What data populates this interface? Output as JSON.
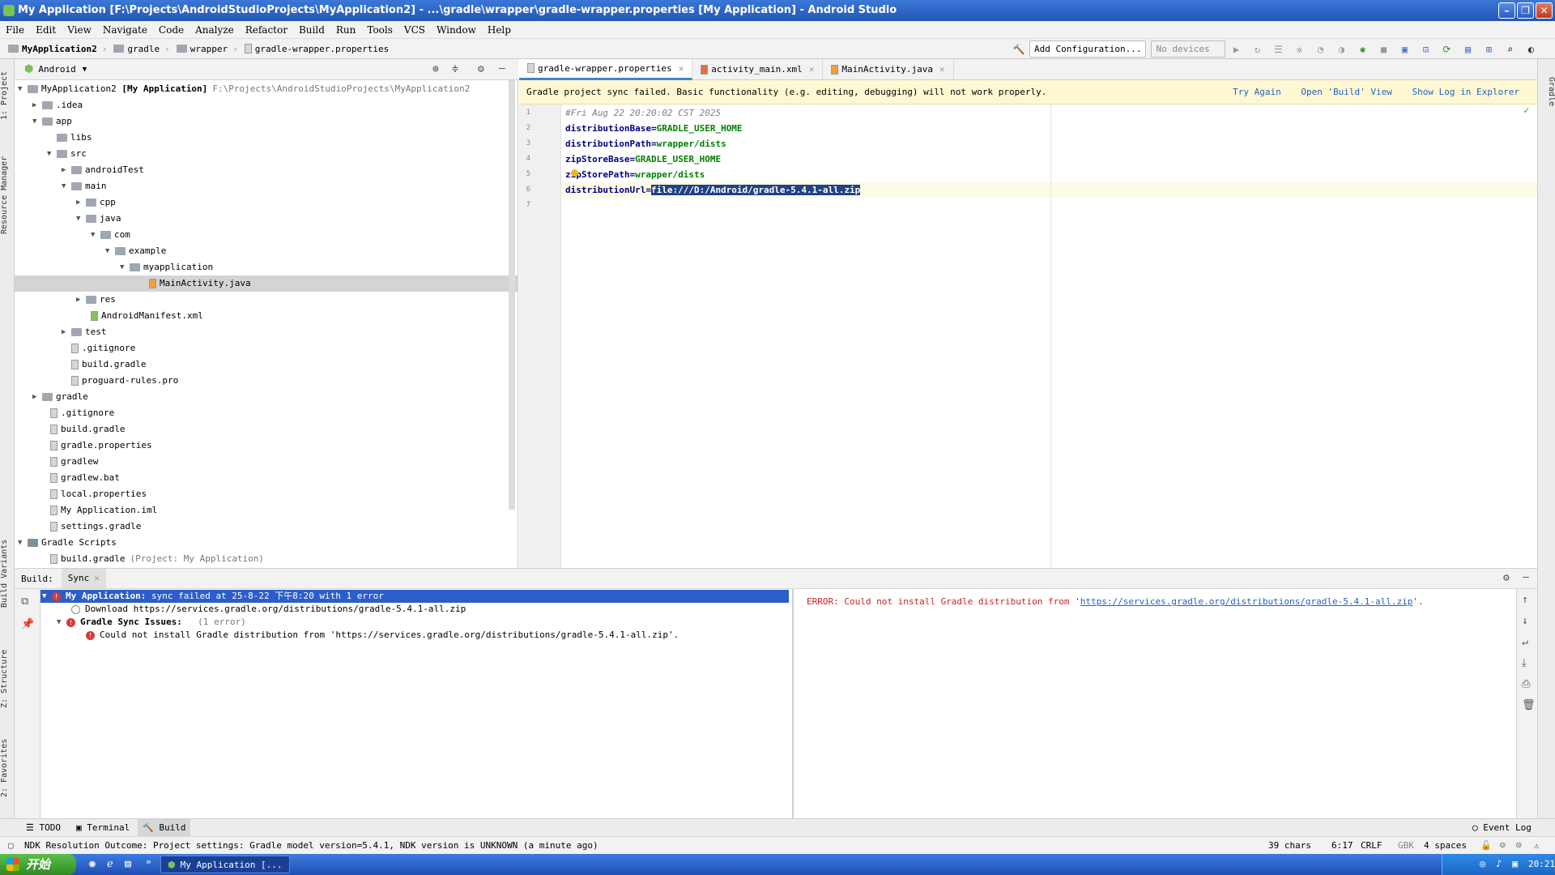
{
  "window": {
    "title": "My Application [F:\\Projects\\AndroidStudioProjects\\MyApplication2] - ...\\gradle\\wrapper\\gradle-wrapper.properties [My Application] - Android Studio"
  },
  "menu": [
    "File",
    "Edit",
    "View",
    "Navigate",
    "Code",
    "Analyze",
    "Refactor",
    "Build",
    "Run",
    "Tools",
    "VCS",
    "Window",
    "Help"
  ],
  "breadcrumb": [
    "MyApplication2",
    "gradle",
    "wrapper",
    "gradle-wrapper.properties"
  ],
  "toolbar": {
    "add_config": "Add Configuration...",
    "devices": "No devices"
  },
  "project": {
    "view": "Android",
    "root_name": "MyApplication2",
    "root_module": "[My Application]",
    "root_path": "F:\\Projects\\AndroidStudioProjects\\MyApplication2",
    "tree": [
      ".idea",
      "app",
      "libs",
      "src",
      "androidTest",
      "main",
      "cpp",
      "java",
      "com",
      "example",
      "myapplication",
      "MainActivity.java",
      "res",
      "AndroidManifest.xml",
      "test",
      ".gitignore",
      "build.gradle",
      "proguard-rules.pro",
      "gradle",
      ".gitignore",
      "build.gradle",
      "gradle.properties",
      "gradlew",
      "gradlew.bat",
      "local.properties",
      "My Application.iml",
      "settings.gradle",
      "Gradle Scripts",
      "build.gradle"
    ],
    "gradle_scripts_hint": "(Project: My Application)"
  },
  "tabs": [
    "gradle-wrapper.properties",
    "activity_main.xml",
    "MainActivity.java"
  ],
  "banner": {
    "message": "Gradle project sync failed. Basic functionality (e.g. editing, debugging) will not work properly.",
    "links": [
      "Try Again",
      "Open 'Build' View",
      "Show Log in Explorer"
    ]
  },
  "editor": {
    "line_numbers": [
      "1",
      "2",
      "3",
      "4",
      "5",
      "6",
      "7"
    ],
    "comment": "#Fri Aug 22 20:20:02 CST 2025",
    "lines": [
      {
        "k": "distributionBase",
        "v": "GRADLE_USER_HOME"
      },
      {
        "k": "distributionPath",
        "v": "wrapper/dists"
      },
      {
        "k": "zipStoreBase",
        "v": "GRADLE_USER_HOME"
      },
      {
        "k": "zipStorePath",
        "v": "wrapper/dists"
      }
    ],
    "url_key": "distributionUrl",
    "url_value": "file:///D:/Android/gradle-5.4.1-all.zip"
  },
  "build": {
    "tab_build": "Build:",
    "tab_sync": "Sync",
    "root": "My Application:",
    "root_detail": "sync failed at 25-8-22 下午8:20  with 1 error",
    "download": "Download https://services.gradle.org/distributions/gradle-5.4.1-all.zip",
    "issues": "Gradle Sync Issues:",
    "issues_count": "(1 error)",
    "issue_msg": "Could not install Gradle distribution from 'https://services.gradle.org/distributions/gradle-5.4.1-all.zip'.",
    "output_prefix": "ERROR: Could not install Gradle distribution from '",
    "output_link": "https://services.gradle.org/distributions/gradle-5.4.1-all.zip",
    "output_suffix": "'."
  },
  "bottom_tools": [
    "TODO",
    "Terminal",
    "Build"
  ],
  "event_log": "Event Log",
  "left_tools": [
    "1: Project",
    "Resource Manager",
    "Build Variants",
    "Z: Structure",
    "2: Favorites"
  ],
  "right_tools": [
    "Gradle"
  ],
  "status": {
    "message": "NDK Resolution Outcome: Project settings: Gradle model version=5.4.1, NDK version is UNKNOWN (a minute ago)",
    "chars": "39 chars",
    "pos": "6:17",
    "eol": "CRLF",
    "encoding": "GBK",
    "indent": "4 spaces"
  },
  "taskbar": {
    "start": "开始",
    "task": "My Application [...",
    "clock": "20:21"
  }
}
